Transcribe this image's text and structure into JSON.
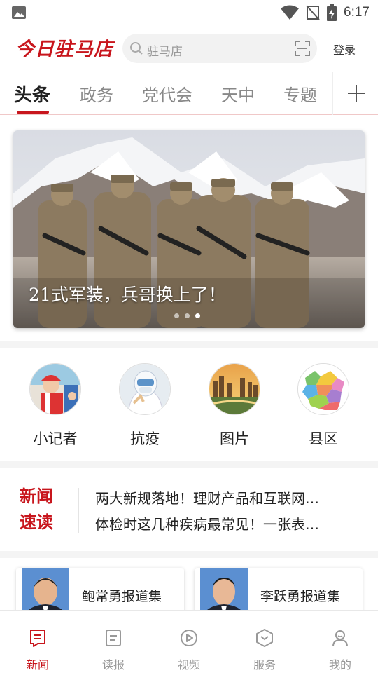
{
  "status_bar": {
    "time": "6:17"
  },
  "header": {
    "logo_text": "今日驻马店",
    "search_placeholder": "驻马店",
    "login_label": "登录"
  },
  "tabs": [
    {
      "label": "头条",
      "active": true
    },
    {
      "label": "政务",
      "active": false
    },
    {
      "label": "党代会",
      "active": false
    },
    {
      "label": "天中",
      "active": false
    },
    {
      "label": "专题",
      "active": false
    }
  ],
  "banner": {
    "caption": "21式军装，兵哥换上了！",
    "slide_count": 3,
    "active_slide": 3
  },
  "categories": [
    {
      "label": "小记者",
      "icon": "kid-reporter-photo"
    },
    {
      "label": "抗疫",
      "icon": "medical-worker-photo"
    },
    {
      "label": "图片",
      "icon": "city-skyline-photo"
    },
    {
      "label": "县区",
      "icon": "county-map-photo"
    }
  ],
  "quick_read": {
    "title_line1": "新闻",
    "title_line2": "速读",
    "items": [
      "两大新规落地！理财产品和互联网…",
      "体检时这几种疾病最常见！一张表…"
    ]
  },
  "reporter_cards": [
    {
      "name": "鲍常勇报道集"
    },
    {
      "name": "李跃勇报道集"
    }
  ],
  "bottom_nav": [
    {
      "label": "新闻",
      "icon": "news-icon",
      "active": true
    },
    {
      "label": "读报",
      "icon": "newspaper-icon",
      "active": false
    },
    {
      "label": "视频",
      "icon": "video-icon",
      "active": false
    },
    {
      "label": "服务",
      "icon": "service-icon",
      "active": false
    },
    {
      "label": "我的",
      "icon": "profile-icon",
      "active": false
    }
  ],
  "colors": {
    "brand_red": "#c8161d",
    "inactive_gray": "#999999"
  }
}
